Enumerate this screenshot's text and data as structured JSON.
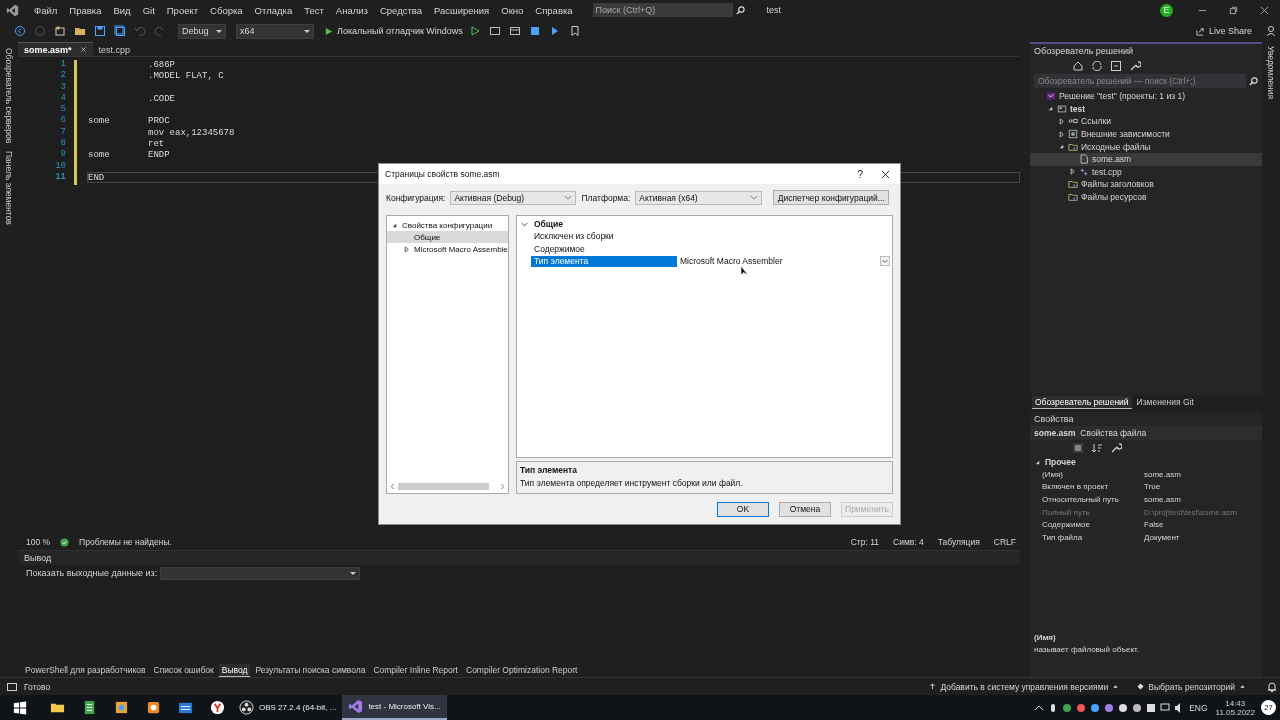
{
  "title_bar": {
    "menu": [
      "Файл",
      "Правка",
      "Вид",
      "Git",
      "Проект",
      "Сборка",
      "Отладка",
      "Тест",
      "Анализ",
      "Средства",
      "Расширения",
      "Окно",
      "Справка"
    ],
    "search": {
      "placeholder": "Поиск (Ctrl+Q)"
    },
    "solution_name": "test",
    "avatar": "E"
  },
  "toolbar": {
    "configuration": "Debug",
    "platform": "x64",
    "debugger": "Локальный отладчик Windows",
    "live_share": "Live Share"
  },
  "side_tabs": [
    "Обозреватель серверов",
    "Панель элементов"
  ],
  "editor": {
    "tabs": [
      {
        "label": "some.asm*",
        "selected": true
      },
      {
        "label": "test.cpp",
        "selected": false
      }
    ],
    "lines": [
      {
        "number": "1",
        "code": ".686P",
        "current": false
      },
      {
        "number": "2",
        "code": ".MODEL FLAT, C",
        "current": false
      },
      {
        "number": "3",
        "current": false
      },
      {
        "number": "4",
        "code": ".CODE",
        "current": false
      },
      {
        "number": "5",
        "current": false
      },
      {
        "number": "6",
        "label": "some",
        "code": "PROC",
        "current": false
      },
      {
        "number": "7",
        "code": "mov eax,12345678",
        "current": false
      },
      {
        "number": "8",
        "code": "ret",
        "current": false
      },
      {
        "number": "9",
        "label": "some",
        "code": "ENDP",
        "current": false
      },
      {
        "number": "10",
        "current": false
      },
      {
        "number": "11",
        "label": "END",
        "current": true
      }
    ],
    "status": {
      "zoom": "100 %",
      "issues": "Проблемы не найдены.",
      "line": "Стр: 11",
      "column": "Симв: 4",
      "indent": "Табуляция",
      "eol": "CRLF"
    }
  },
  "output": {
    "title": "Вывод",
    "source_label": "Показать выходные данные из:"
  },
  "bottom_tabs": [
    {
      "label": "PowerShell для разработчиков",
      "selected": false
    },
    {
      "label": "Список ошибок",
      "selected": false
    },
    {
      "label": "Вывод",
      "selected": true
    },
    {
      "label": "Результаты поиска символа",
      "selected": false
    },
    {
      "label": "Compiler Inline Report",
      "selected": false
    },
    {
      "label": "Compiler Optimization Report",
      "selected": false
    }
  ],
  "solution_explorer": {
    "title": "Обозреватель решений",
    "search": {
      "placeholder": "Обозреватель решений — поиск (Ctrl+;)"
    },
    "tree": [
      {
        "label": "Решение \"test\" (проекты: 1 из 1)",
        "kind": "solution",
        "selected": false,
        "children": [
          {
            "label": "test",
            "kind": "project",
            "expanded": true,
            "selected": false,
            "children": [
              {
                "label": "Ссылки",
                "kind": "references",
                "expanded": false,
                "selected": false
              },
              {
                "label": "Внешние зависимости",
                "kind": "dependencies",
                "expanded": false,
                "selected": false
              },
              {
                "label": "Исходные файлы",
                "kind": "filter",
                "expanded": true,
                "selected": false,
                "children": [
                  {
                    "label": "some.asm",
                    "kind": "file",
                    "selected": true
                  },
                  {
                    "label": "test.cpp",
                    "kind": "cpp",
                    "expanded": false,
                    "selected": false
                  }
                ]
              },
              {
                "label": "Файлы заголовков",
                "kind": "filter",
                "selected": false
              },
              {
                "label": "Файлы ресурсов",
                "kind": "filter",
                "selected": false
              }
            ]
          }
        ]
      }
    ]
  },
  "panel_tabs": [
    {
      "label": "Обозреватель решений",
      "selected": true
    },
    {
      "label": "Изменения Git",
      "selected": false
    }
  ],
  "properties": {
    "title": "Свойства",
    "object": "some.asm",
    "object_type": "Свойства файла",
    "category": "Прочее",
    "rows": [
      {
        "name": "(Имя)",
        "value": "some.asm",
        "disabled": false
      },
      {
        "name": "Включен в проект",
        "value": "True",
        "disabled": false
      },
      {
        "name": "Относительный путь",
        "value": "some.asm",
        "disabled": false
      },
      {
        "name": "Полный путь",
        "value": "D:\\proj\\test\\test\\some.asm",
        "disabled": true
      },
      {
        "name": "Содержимое",
        "value": "False",
        "disabled": false
      },
      {
        "name": "Тип файла",
        "value": "Документ",
        "disabled": false
      }
    ],
    "description": {
      "title": "(Имя)",
      "text": "называет файловый объект."
    }
  },
  "notifications_tab": "Уведомления",
  "status_bar": {
    "state": "Готово",
    "source_control": "Добавить в систему управления версиями",
    "repository": "Выбрать репозиторий"
  },
  "taskbar": {
    "apps": [
      {
        "kind": "explorer",
        "selected": false
      },
      {
        "kind": "sheet",
        "selected": false
      },
      {
        "kind": "paint",
        "selected": false
      },
      {
        "kind": "orange",
        "selected": false
      },
      {
        "kind": "calendar",
        "selected": false
      },
      {
        "kind": "yandex",
        "selected": false
      },
      {
        "kind": "obs",
        "label": "OBS 27.2.4 (64-bit, ...",
        "selected": false
      },
      {
        "kind": "vs",
        "label": "test - Microsoft Vis...",
        "selected": true
      }
    ],
    "language": "ENG",
    "time": "14:43",
    "date": "11.05.2022",
    "notifications": "27"
  },
  "dialog": {
    "title": "Страницы свойств some.asm",
    "help": "?",
    "config_label": "Конфигурация:",
    "config": "Активная (Debug)",
    "platform_label": "Платформа:",
    "platform": "Активная (x64)",
    "manager_button": "Диспетчер конфигураций...",
    "tree": [
      {
        "label": "Свойства конфигурации",
        "expanded": true,
        "selected": false,
        "children": [
          {
            "label": "Общие",
            "selected": true
          },
          {
            "label": "Microsoft Macro Assemble",
            "expanded": false,
            "selected": false
          }
        ]
      }
    ],
    "category": "Общие",
    "rows": [
      {
        "name": "Исключен из сборки",
        "selected": false
      },
      {
        "name": "Содержимое",
        "selected": false
      },
      {
        "name": "Тип элемента",
        "value": "Microsoft Macro Assembler",
        "selected": true
      }
    ],
    "description": {
      "title": "Тип элемента",
      "text": "Тип элемента определяет инструмент сборки или файл."
    },
    "buttons": [
      {
        "label": "OK",
        "kind": "default",
        "disabled": false
      },
      {
        "label": "Отмена",
        "kind": "normal",
        "disabled": false
      },
      {
        "label": "Применить",
        "kind": "normal",
        "disabled": true
      }
    ]
  }
}
